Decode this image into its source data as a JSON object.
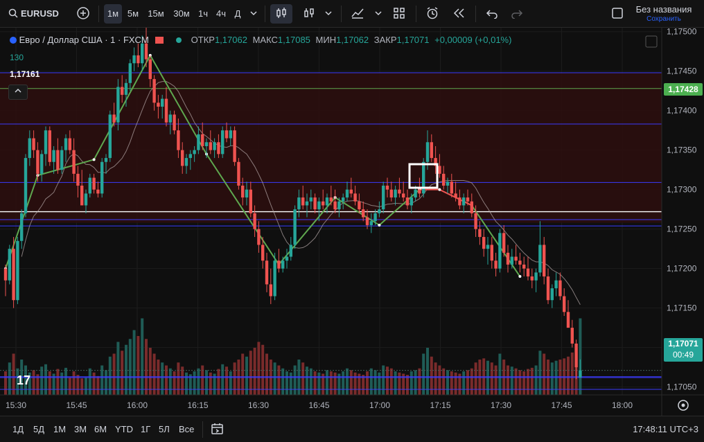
{
  "symbol": "EURUSD",
  "intervals": [
    {
      "label": "1м",
      "active": true
    },
    {
      "label": "5м",
      "active": false
    },
    {
      "label": "15м",
      "active": false
    },
    {
      "label": "30м",
      "active": false
    },
    {
      "label": "1ч",
      "active": false
    },
    {
      "label": "4ч",
      "active": false
    },
    {
      "label": "Д",
      "active": false
    }
  ],
  "layout": {
    "title": "Без названия",
    "save_label": "Сохранить"
  },
  "legend": {
    "instrument": "Евро / Доллар США · 1 · FXCM",
    "open_label": "ОТКР",
    "open": "1,17062",
    "high_label": "МАКС",
    "high": "1,17085",
    "low_label": "МИН",
    "low": "1,17062",
    "close_label": "ЗАКР",
    "close": "1,17071",
    "change": "+0,00009 (+0,01%)",
    "volume": "130",
    "level_value": "1,17161"
  },
  "price_axis": {
    "labels": [
      "1,17500",
      "1,17450",
      "1,17400",
      "1,17350",
      "1,17300",
      "1,17250",
      "1,17200",
      "1,17150",
      "1,17100",
      "1,17050"
    ],
    "marker_green": "1,17428",
    "marker_current": "1,17071",
    "countdown": "00:49"
  },
  "time_axis": {
    "labels": [
      "15:30",
      "15:45",
      "16:00",
      "16:15",
      "16:30",
      "16:45",
      "17:00",
      "17:15",
      "17:30",
      "17:45",
      "18:00"
    ]
  },
  "ranges": [
    "1Д",
    "5Д",
    "1М",
    "3М",
    "6М",
    "YTD",
    "1Г",
    "5Л",
    "Все"
  ],
  "clock": "17:48:11 UTC+3",
  "colors": {
    "up": "#26a69a",
    "down": "#ef5350",
    "zone": "#2d0e0e",
    "hline_blue": "#3b3bff",
    "hline_green": "#5fa84f",
    "bg": "#0f0f0f"
  },
  "chart_data": {
    "type": "candlestick",
    "x_range": [
      "15:29",
      "17:51"
    ],
    "y_range": [
      1.1704,
      1.17505
    ],
    "candles": [
      [
        1.172,
        1.17205,
        1.17165,
        1.17185
      ],
      [
        1.17185,
        1.1723,
        1.1718,
        1.17225
      ],
      [
        1.17225,
        1.1724,
        1.1715,
        1.1716
      ],
      [
        1.1716,
        1.1724,
        1.17155,
        1.17235
      ],
      [
        1.17235,
        1.17275,
        1.17225,
        1.1727
      ],
      [
        1.1727,
        1.17345,
        1.17265,
        1.1734
      ],
      [
        1.1734,
        1.17375,
        1.1733,
        1.17365
      ],
      [
        1.17365,
        1.17375,
        1.1734,
        1.1735
      ],
      [
        1.1735,
        1.1736,
        1.1731,
        1.1732
      ],
      [
        1.1732,
        1.1735,
        1.1731,
        1.17345
      ],
      [
        1.17345,
        1.1738,
        1.1733,
        1.17375
      ],
      [
        1.17375,
        1.1738,
        1.1733,
        1.17335
      ],
      [
        1.17335,
        1.17355,
        1.1732,
        1.1735
      ],
      [
        1.1735,
        1.17365,
        1.1732,
        1.17325
      ],
      [
        1.17325,
        1.17355,
        1.1732,
        1.1735
      ],
      [
        1.1735,
        1.1737,
        1.17335,
        1.17365
      ],
      [
        1.17365,
        1.17375,
        1.17345,
        1.1735
      ],
      [
        1.1735,
        1.17365,
        1.1731,
        1.1732
      ],
      [
        1.1732,
        1.1733,
        1.1729,
        1.17305
      ],
      [
        1.17305,
        1.17325,
        1.17295,
        1.1728
      ],
      [
        1.1728,
        1.173,
        1.1727,
        1.17295
      ],
      [
        1.17295,
        1.1732,
        1.1729,
        1.17315
      ],
      [
        1.17315,
        1.1732,
        1.17295,
        1.173
      ],
      [
        1.173,
        1.1731,
        1.1729,
        1.17295
      ],
      [
        1.17295,
        1.1734,
        1.1729,
        1.17335
      ],
      [
        1.17335,
        1.17345,
        1.1732,
        1.1734
      ],
      [
        1.1734,
        1.174,
        1.17335,
        1.17395
      ],
      [
        1.17395,
        1.1741,
        1.1738,
        1.17385
      ],
      [
        1.17385,
        1.1744,
        1.17375,
        1.1743
      ],
      [
        1.1743,
        1.17445,
        1.1741,
        1.1742
      ],
      [
        1.1742,
        1.1744,
        1.17405,
        1.17435
      ],
      [
        1.17435,
        1.17465,
        1.17425,
        1.1746
      ],
      [
        1.1746,
        1.1748,
        1.1745,
        1.1747
      ],
      [
        1.1747,
        1.17485,
        1.17455,
        1.1746
      ],
      [
        1.1746,
        1.17495,
        1.1745,
        1.17485
      ],
      [
        1.17485,
        1.17505,
        1.17455,
        1.17465
      ],
      [
        1.17465,
        1.1747,
        1.1743,
        1.1744
      ],
      [
        1.1744,
        1.17445,
        1.174,
        1.1741
      ],
      [
        1.1741,
        1.1742,
        1.1739,
        1.17405
      ],
      [
        1.17405,
        1.1742,
        1.1739,
        1.17415
      ],
      [
        1.17415,
        1.1743,
        1.1738,
        1.17385
      ],
      [
        1.17385,
        1.174,
        1.1737,
        1.17395
      ],
      [
        1.17395,
        1.174,
        1.1737,
        1.17375
      ],
      [
        1.17375,
        1.1739,
        1.1734,
        1.1735
      ],
      [
        1.1735,
        1.1736,
        1.1732,
        1.1733
      ],
      [
        1.1733,
        1.17345,
        1.1732,
        1.1734
      ],
      [
        1.1734,
        1.1735,
        1.17325,
        1.17345
      ],
      [
        1.17345,
        1.17355,
        1.17335,
        1.1735
      ],
      [
        1.1735,
        1.1738,
        1.17345,
        1.1737
      ],
      [
        1.1737,
        1.17385,
        1.1735,
        1.17355
      ],
      [
        1.17355,
        1.17365,
        1.1734,
        1.1736
      ],
      [
        1.1736,
        1.17375,
        1.17345,
        1.1735
      ],
      [
        1.1735,
        1.17365,
        1.1734,
        1.1736
      ],
      [
        1.1736,
        1.1737,
        1.1734,
        1.17345
      ],
      [
        1.17345,
        1.1738,
        1.1734,
        1.17375
      ],
      [
        1.17375,
        1.17385,
        1.1736,
        1.17365
      ],
      [
        1.17365,
        1.1738,
        1.17355,
        1.17375
      ],
      [
        1.17375,
        1.1738,
        1.1733,
        1.17335
      ],
      [
        1.17335,
        1.1734,
        1.173,
        1.17305
      ],
      [
        1.17305,
        1.17315,
        1.1728,
        1.1729
      ],
      [
        1.1729,
        1.1731,
        1.1728,
        1.173
      ],
      [
        1.173,
        1.1731,
        1.17265,
        1.1727
      ],
      [
        1.1727,
        1.1728,
        1.1724,
        1.1725
      ],
      [
        1.1725,
        1.1726,
        1.1722,
        1.1723
      ],
      [
        1.1723,
        1.1724,
        1.172,
        1.1721
      ],
      [
        1.1721,
        1.1722,
        1.1717,
        1.1718
      ],
      [
        1.1718,
        1.172,
        1.17155,
        1.17165
      ],
      [
        1.17165,
        1.1722,
        1.1716,
        1.1721
      ],
      [
        1.1721,
        1.17225,
        1.17195,
        1.172
      ],
      [
        1.172,
        1.17215,
        1.17195,
        1.1721
      ],
      [
        1.1721,
        1.17225,
        1.172,
        1.17215
      ],
      [
        1.17215,
        1.1724,
        1.1721,
        1.1723
      ],
      [
        1.1723,
        1.1728,
        1.17225,
        1.17275
      ],
      [
        1.17275,
        1.173,
        1.17265,
        1.1729
      ],
      [
        1.1729,
        1.17305,
        1.17275,
        1.1728
      ],
      [
        1.1728,
        1.17295,
        1.17265,
        1.17285
      ],
      [
        1.17285,
        1.173,
        1.17275,
        1.1729
      ],
      [
        1.1729,
        1.17295,
        1.1727,
        1.17275
      ],
      [
        1.17275,
        1.1729,
        1.1726,
        1.17285
      ],
      [
        1.17285,
        1.173,
        1.17275,
        1.1728
      ],
      [
        1.1728,
        1.17295,
        1.1727,
        1.1729
      ],
      [
        1.1729,
        1.17305,
        1.1728,
        1.17285
      ],
      [
        1.17285,
        1.173,
        1.1727,
        1.17275
      ],
      [
        1.17275,
        1.1729,
        1.17265,
        1.17285
      ],
      [
        1.17285,
        1.17295,
        1.17275,
        1.1729
      ],
      [
        1.1729,
        1.1731,
        1.17285,
        1.173
      ],
      [
        1.173,
        1.17315,
        1.1729,
        1.17295
      ],
      [
        1.17295,
        1.17305,
        1.1728,
        1.17285
      ],
      [
        1.17285,
        1.17295,
        1.1727,
        1.17275
      ],
      [
        1.17275,
        1.17285,
        1.1726,
        1.17265
      ],
      [
        1.17265,
        1.17275,
        1.1725,
        1.17255
      ],
      [
        1.17255,
        1.1727,
        1.17245,
        1.1726
      ],
      [
        1.1726,
        1.17275,
        1.17255,
        1.1727
      ],
      [
        1.1727,
        1.17285,
        1.17265,
        1.17275
      ],
      [
        1.17275,
        1.1731,
        1.1727,
        1.17305
      ],
      [
        1.17305,
        1.17315,
        1.1729,
        1.173
      ],
      [
        1.173,
        1.1731,
        1.17285,
        1.1729
      ],
      [
        1.1729,
        1.17305,
        1.1728,
        1.173
      ],
      [
        1.173,
        1.17315,
        1.1729,
        1.17295
      ],
      [
        1.17295,
        1.1731,
        1.17285,
        1.1729
      ],
      [
        1.1729,
        1.173,
        1.17275,
        1.1728
      ],
      [
        1.1728,
        1.17295,
        1.1727,
        1.1729
      ],
      [
        1.1729,
        1.17305,
        1.17285,
        1.173
      ],
      [
        1.173,
        1.17315,
        1.1729,
        1.17295
      ],
      [
        1.17295,
        1.1734,
        1.1729,
        1.17335
      ],
      [
        1.17335,
        1.17375,
        1.17325,
        1.1736
      ],
      [
        1.1736,
        1.1737,
        1.17335,
        1.1734
      ],
      [
        1.1734,
        1.17355,
        1.1732,
        1.1733
      ],
      [
        1.1733,
        1.17345,
        1.17315,
        1.1732
      ],
      [
        1.1732,
        1.1733,
        1.173,
        1.17305
      ],
      [
        1.17305,
        1.17315,
        1.17295,
        1.1731
      ],
      [
        1.1731,
        1.1732,
        1.1729,
        1.17295
      ],
      [
        1.17295,
        1.1731,
        1.17285,
        1.1729
      ],
      [
        1.1729,
        1.173,
        1.17275,
        1.1728
      ],
      [
        1.1728,
        1.17295,
        1.1727,
        1.1729
      ],
      [
        1.1729,
        1.173,
        1.1728,
        1.17285
      ],
      [
        1.17285,
        1.17295,
        1.17265,
        1.1727
      ],
      [
        1.1727,
        1.1728,
        1.1724,
        1.1725
      ],
      [
        1.1725,
        1.1726,
        1.1723,
        1.1724
      ],
      [
        1.1724,
        1.1725,
        1.17215,
        1.17225
      ],
      [
        1.17225,
        1.1724,
        1.17205,
        1.1723
      ],
      [
        1.1723,
        1.1724,
        1.172,
        1.1721
      ],
      [
        1.1721,
        1.1722,
        1.1719,
        1.172
      ],
      [
        1.172,
        1.1725,
        1.17195,
        1.17245
      ],
      [
        1.17245,
        1.17255,
        1.17215,
        1.1722
      ],
      [
        1.1722,
        1.1723,
        1.17195,
        1.17205
      ],
      [
        1.17205,
        1.17225,
        1.172,
        1.17215
      ],
      [
        1.17215,
        1.1723,
        1.17205,
        1.1721
      ],
      [
        1.1721,
        1.1722,
        1.17195,
        1.17205
      ],
      [
        1.17205,
        1.17215,
        1.1719,
        1.172
      ],
      [
        1.172,
        1.17215,
        1.17185,
        1.1719
      ],
      [
        1.1719,
        1.172,
        1.17175,
        1.17185
      ],
      [
        1.17185,
        1.172,
        1.1717,
        1.17195
      ],
      [
        1.17195,
        1.1726,
        1.1719,
        1.1723
      ],
      [
        1.1723,
        1.1724,
        1.1718,
        1.1719
      ],
      [
        1.1719,
        1.172,
        1.17155,
        1.1716
      ],
      [
        1.1716,
        1.1718,
        1.1715,
        1.17175
      ],
      [
        1.17175,
        1.17195,
        1.17165,
        1.17185
      ],
      [
        1.17185,
        1.17195,
        1.1716,
        1.17165
      ],
      [
        1.17165,
        1.17175,
        1.1714,
        1.17145
      ],
      [
        1.17145,
        1.1716,
        1.1713,
        1.17125
      ],
      [
        1.17125,
        1.17135,
        1.171,
        1.17105
      ],
      [
        1.17105,
        1.1711,
        1.1706,
        1.17075
      ],
      [
        1.17062,
        1.17085,
        1.17062,
        1.17071
      ]
    ],
    "volumes": [
      40,
      55,
      70,
      45,
      60,
      50,
      38,
      42,
      35,
      48,
      52,
      40,
      36,
      44,
      38,
      46,
      30,
      40,
      34,
      28,
      30,
      45,
      38,
      32,
      50,
      42,
      65,
      70,
      90,
      75,
      85,
      95,
      110,
      100,
      130,
      95,
      80,
      70,
      60,
      55,
      50,
      45,
      40,
      55,
      48,
      38,
      35,
      40,
      45,
      50,
      42,
      38,
      36,
      44,
      52,
      48,
      40,
      55,
      60,
      70,
      65,
      75,
      80,
      90,
      85,
      70,
      60,
      55,
      50,
      45,
      40,
      38,
      50,
      60,
      55,
      48,
      45,
      40,
      38,
      36,
      42,
      40,
      38,
      36,
      40,
      45,
      42,
      38,
      36,
      34,
      40,
      45,
      42,
      38,
      50,
      48,
      45,
      40,
      38,
      36,
      34,
      40,
      42,
      45,
      70,
      80,
      65,
      55,
      50,
      45,
      42,
      40,
      38,
      36,
      40,
      42,
      45,
      55,
      60,
      62,
      58,
      55,
      50,
      70,
      60,
      50,
      48,
      45,
      42,
      40,
      44,
      46,
      50,
      75,
      70,
      60,
      55,
      58,
      60,
      62,
      65,
      72,
      80,
      130
    ]
  }
}
